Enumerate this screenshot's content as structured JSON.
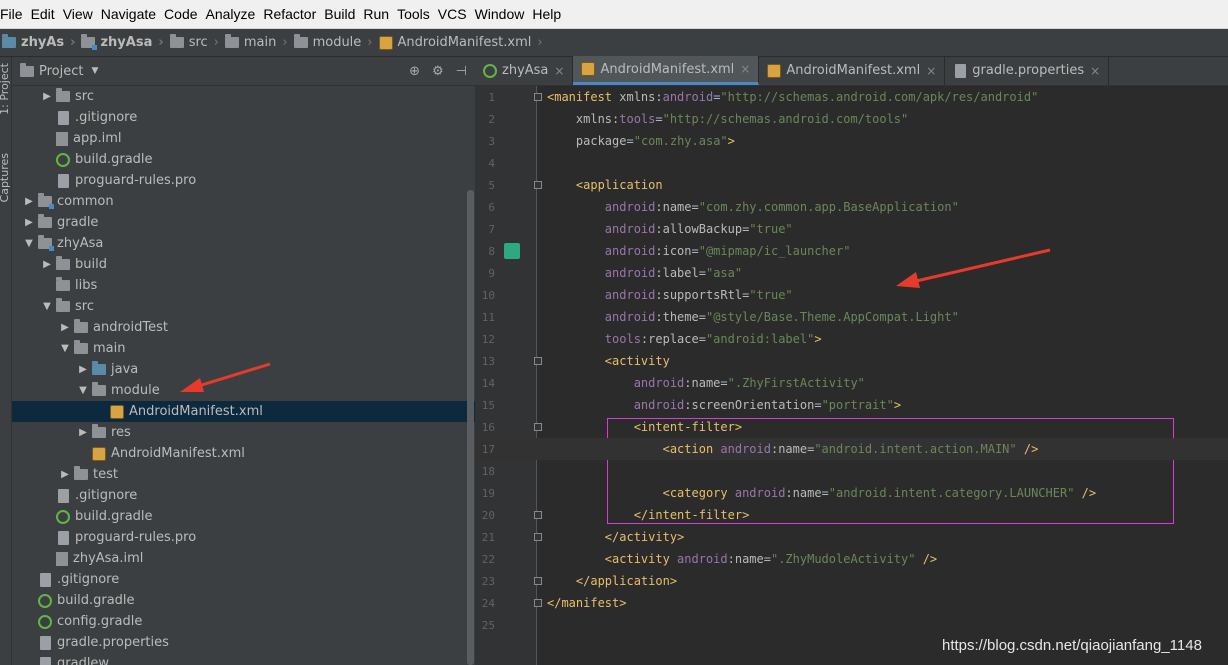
{
  "menu": [
    "File",
    "Edit",
    "View",
    "Navigate",
    "Code",
    "Analyze",
    "Refactor",
    "Build",
    "Run",
    "Tools",
    "VCS",
    "Window",
    "Help"
  ],
  "breadcrumb": [
    "zhyAs",
    "zhyAsa",
    "src",
    "main",
    "module",
    "AndroidManifest.xml"
  ],
  "side_strip": {
    "project": "1: Project",
    "captures": "Captures"
  },
  "project_panel": {
    "title": "Project"
  },
  "tree": [
    {
      "label": "src",
      "level": 2,
      "arrow": "right",
      "icon": "folder"
    },
    {
      "label": ".gitignore",
      "level": 2,
      "arrow": "",
      "icon": "file"
    },
    {
      "label": "app.iml",
      "level": 2,
      "arrow": "",
      "icon": "iml"
    },
    {
      "label": "build.gradle",
      "level": 2,
      "arrow": "",
      "icon": "gradle"
    },
    {
      "label": "proguard-rules.pro",
      "level": 2,
      "arrow": "",
      "icon": "file"
    },
    {
      "label": "common",
      "level": 1,
      "arrow": "right",
      "icon": "module"
    },
    {
      "label": "gradle",
      "level": 1,
      "arrow": "right",
      "icon": "folder"
    },
    {
      "label": "zhyAsa",
      "level": 1,
      "arrow": "down",
      "icon": "module"
    },
    {
      "label": "build",
      "level": 2,
      "arrow": "right",
      "icon": "folder"
    },
    {
      "label": "libs",
      "level": 2,
      "arrow": "",
      "icon": "folder"
    },
    {
      "label": "src",
      "level": 2,
      "arrow": "down",
      "icon": "folder"
    },
    {
      "label": "androidTest",
      "level": 3,
      "arrow": "right",
      "icon": "folder"
    },
    {
      "label": "main",
      "level": 3,
      "arrow": "down",
      "icon": "folder"
    },
    {
      "label": "java",
      "level": 4,
      "arrow": "right",
      "icon": "folder-blue"
    },
    {
      "label": "module",
      "level": 4,
      "arrow": "down",
      "icon": "folder"
    },
    {
      "label": "AndroidManifest.xml",
      "level": 5,
      "arrow": "",
      "icon": "xml",
      "selected": true
    },
    {
      "label": "res",
      "level": 4,
      "arrow": "right",
      "icon": "folder"
    },
    {
      "label": "AndroidManifest.xml",
      "level": 4,
      "arrow": "",
      "icon": "xml"
    },
    {
      "label": "test",
      "level": 3,
      "arrow": "right",
      "icon": "folder"
    },
    {
      "label": ".gitignore",
      "level": 2,
      "arrow": "",
      "icon": "file"
    },
    {
      "label": "build.gradle",
      "level": 2,
      "arrow": "",
      "icon": "gradle"
    },
    {
      "label": "proguard-rules.pro",
      "level": 2,
      "arrow": "",
      "icon": "file"
    },
    {
      "label": "zhyAsa.iml",
      "level": 2,
      "arrow": "",
      "icon": "iml"
    },
    {
      "label": ".gitignore",
      "level": 1,
      "arrow": "",
      "icon": "file"
    },
    {
      "label": "build.gradle",
      "level": 1,
      "arrow": "",
      "icon": "gradle"
    },
    {
      "label": "config.gradle",
      "level": 1,
      "arrow": "",
      "icon": "gradle"
    },
    {
      "label": "gradle.properties",
      "level": 1,
      "arrow": "",
      "icon": "file"
    },
    {
      "label": "gradlew",
      "level": 1,
      "arrow": "",
      "icon": "file"
    }
  ],
  "tabs": [
    {
      "label": "zhyAsa",
      "icon": "gradle",
      "active": false
    },
    {
      "label": "AndroidManifest.xml",
      "icon": "xml",
      "active": true
    },
    {
      "label": "AndroidManifest.xml",
      "icon": "xml",
      "active": false
    },
    {
      "label": "gradle.properties",
      "icon": "file",
      "active": false
    }
  ],
  "code_lines": [
    [
      [
        "tag",
        "<manifest "
      ],
      [
        "attr",
        "xmlns:"
      ],
      [
        "ns",
        "android"
      ],
      [
        "eq",
        "="
      ],
      [
        "val",
        "\"http://schemas.android.com/apk/res/android\""
      ]
    ],
    [
      [
        "attr",
        "    xmlns:"
      ],
      [
        "ns",
        "tools"
      ],
      [
        "eq",
        "="
      ],
      [
        "val",
        "\"http://schemas.android.com/tools\""
      ]
    ],
    [
      [
        "attr",
        "    package"
      ],
      [
        "eq",
        "="
      ],
      [
        "val",
        "\"com.zhy.asa\""
      ],
      [
        "tag",
        ">"
      ]
    ],
    [],
    [
      [
        "tag",
        "    <application"
      ]
    ],
    [
      [
        "ns",
        "        android"
      ],
      [
        "attr",
        ":name"
      ],
      [
        "eq",
        "="
      ],
      [
        "val",
        "\"com.zhy.common.app.BaseApplication\""
      ]
    ],
    [
      [
        "ns",
        "        android"
      ],
      [
        "attr",
        ":allowBackup"
      ],
      [
        "eq",
        "="
      ],
      [
        "val",
        "\"true\""
      ]
    ],
    [
      [
        "ns",
        "        android"
      ],
      [
        "attr",
        ":icon"
      ],
      [
        "eq",
        "="
      ],
      [
        "val",
        "\"@mipmap/ic_launcher\""
      ]
    ],
    [
      [
        "ns",
        "        android"
      ],
      [
        "attr",
        ":label"
      ],
      [
        "eq",
        "="
      ],
      [
        "val",
        "\"asa\""
      ]
    ],
    [
      [
        "ns",
        "        android"
      ],
      [
        "attr",
        ":supportsRtl"
      ],
      [
        "eq",
        "="
      ],
      [
        "val",
        "\"true\""
      ]
    ],
    [
      [
        "ns",
        "        android"
      ],
      [
        "attr",
        ":theme"
      ],
      [
        "eq",
        "="
      ],
      [
        "val",
        "\"@style/Base.Theme.AppCompat.Light\""
      ]
    ],
    [
      [
        "ns",
        "        tools"
      ],
      [
        "attr",
        ":replace"
      ],
      [
        "eq",
        "="
      ],
      [
        "val",
        "\"android:label\""
      ],
      [
        "tag",
        ">"
      ]
    ],
    [
      [
        "tag",
        "        <activity"
      ]
    ],
    [
      [
        "ns",
        "            android"
      ],
      [
        "attr",
        ":name"
      ],
      [
        "eq",
        "="
      ],
      [
        "val",
        "\".ZhyFirstActivity\""
      ]
    ],
    [
      [
        "ns",
        "            android"
      ],
      [
        "attr",
        ":screenOrientation"
      ],
      [
        "eq",
        "="
      ],
      [
        "val",
        "\"portrait\""
      ],
      [
        "tag",
        ">"
      ]
    ],
    [
      [
        "tag",
        "            <intent-filter>"
      ]
    ],
    [
      [
        "tag",
        "                <action "
      ],
      [
        "ns",
        "android"
      ],
      [
        "attr",
        ":name"
      ],
      [
        "eq",
        "="
      ],
      [
        "val",
        "\"android.intent.action.MAIN\""
      ],
      [
        "tag",
        " />"
      ]
    ],
    [],
    [
      [
        "tag",
        "                <category "
      ],
      [
        "ns",
        "android"
      ],
      [
        "attr",
        ":name"
      ],
      [
        "eq",
        "="
      ],
      [
        "val",
        "\"android.intent.category.LAUNCHER\""
      ],
      [
        "tag",
        " />"
      ]
    ],
    [
      [
        "tag",
        "            </intent-filter>"
      ]
    ],
    [
      [
        "tag",
        "        </activity>"
      ]
    ],
    [
      [
        "tag",
        "        <activity "
      ],
      [
        "ns",
        "android"
      ],
      [
        "attr",
        ":name"
      ],
      [
        "eq",
        "="
      ],
      [
        "val",
        "\".ZhyMudoleActivity\""
      ],
      [
        "tag",
        " />"
      ]
    ],
    [
      [
        "tag",
        "    </application>"
      ]
    ],
    [
      [
        "tag",
        "</manifest>"
      ]
    ],
    []
  ],
  "line_numbers": [
    "1",
    "2",
    "3",
    "4",
    "5",
    "6",
    "7",
    "8",
    "9",
    "10",
    "11",
    "12",
    "13",
    "14",
    "15",
    "16",
    "17",
    "18",
    "19",
    "20",
    "21",
    "22",
    "23",
    "24",
    "25"
  ],
  "watermark": "https://blog.csdn.net/qiaojianfang_1148"
}
